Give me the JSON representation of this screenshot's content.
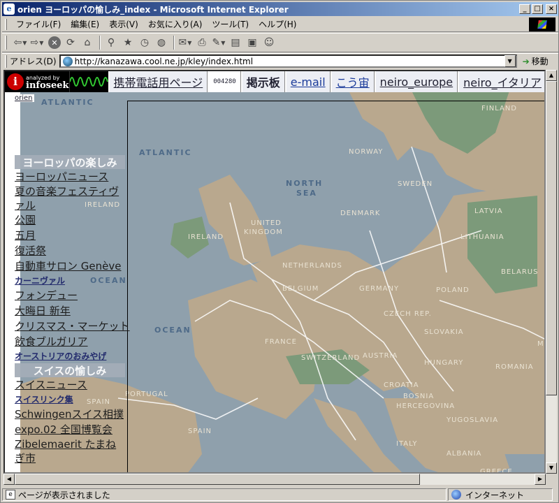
{
  "window": {
    "title": "orien ヨーロッパの愉しみ_index - Microsoft Internet Explorer",
    "controls": [
      "_",
      "□",
      "×"
    ]
  },
  "menubar": {
    "items": [
      "ファイル(F)",
      "編集(E)",
      "表示(V)",
      "お気に入り(A)",
      "ツール(T)",
      "ヘルプ(H)"
    ]
  },
  "toolbar": {
    "buttons": [
      "back-icon",
      "forward-icon",
      "stop-icon",
      "refresh-icon",
      "home-icon",
      "search-icon",
      "favorites-icon",
      "history-icon",
      "mail-icon",
      "print-icon",
      "edit-icon",
      "discuss-icon",
      "messenger-icon"
    ]
  },
  "address": {
    "label": "アドレス(D)",
    "url": "http://kanazawa.cool.ne.jp/kley/index.html",
    "go": "移動"
  },
  "banner": {
    "logo_small": "analyzed by",
    "logo_big": "infoseek",
    "links": [
      "携帯電話用ページ",
      "004280",
      "掲示板",
      "e-mail",
      "こう宙",
      "neiro_europe",
      "neiro_イタリア"
    ]
  },
  "page": {
    "crumb": "orien"
  },
  "sidebar": {
    "europe_heading": "ヨーロッパの楽しみ",
    "europe_items": [
      "ヨーロッパニュース",
      "夏の音楽フェスティヴァル",
      "公園",
      "五月",
      "復活祭",
      "自動車サロン Genève",
      "カーニヴァル",
      "フォンデュー",
      "大晦日 新年",
      "クリスマス・マーケット",
      "飲食ブルガリア",
      "オーストリアのおみやげ"
    ],
    "swiss_heading": "スイスの愉しみ",
    "swiss_items": [
      "スイスニュース",
      "スイスリンク集",
      "Schwingenスイス相撲",
      "expo.02 全国博覧会",
      "Zibelemaerit たまねぎ市"
    ]
  },
  "map": {
    "labels": [
      "ATLANTIC",
      "ATLANTIC",
      "OCEAN",
      "OCEAN",
      "NORTH",
      "SEA",
      "FINLAND",
      "NORWAY",
      "SWEDEN",
      "DENMARK",
      "LATVIA",
      "LITHUANIA",
      "BELARUS",
      "UNITED",
      "KINGDOM",
      "IRELAND",
      "IRELAND",
      "NETHERLANDS",
      "BELGIUM",
      "GERMANY",
      "POLAND",
      "CZECH REP.",
      "SLOVAKIA",
      "FRANCE",
      "SWITZERLAND",
      "AUSTRIA",
      "HUNGARY",
      "ROMANIA",
      "MOLD",
      "CROATIA",
      "BOSNIA",
      "HERCEGOVINA",
      "YUGOSLAVIA",
      "ITALY",
      "ALBANIA",
      "GREECE",
      "PORTUGAL",
      "SPAIN",
      "SPAIN"
    ],
    "colors": {
      "sea": "#8fa0ac",
      "land": "#b9a88e",
      "forest": "#7c9a7a"
    }
  },
  "status": {
    "text": "ページが表示されました",
    "zone": "インターネット"
  }
}
